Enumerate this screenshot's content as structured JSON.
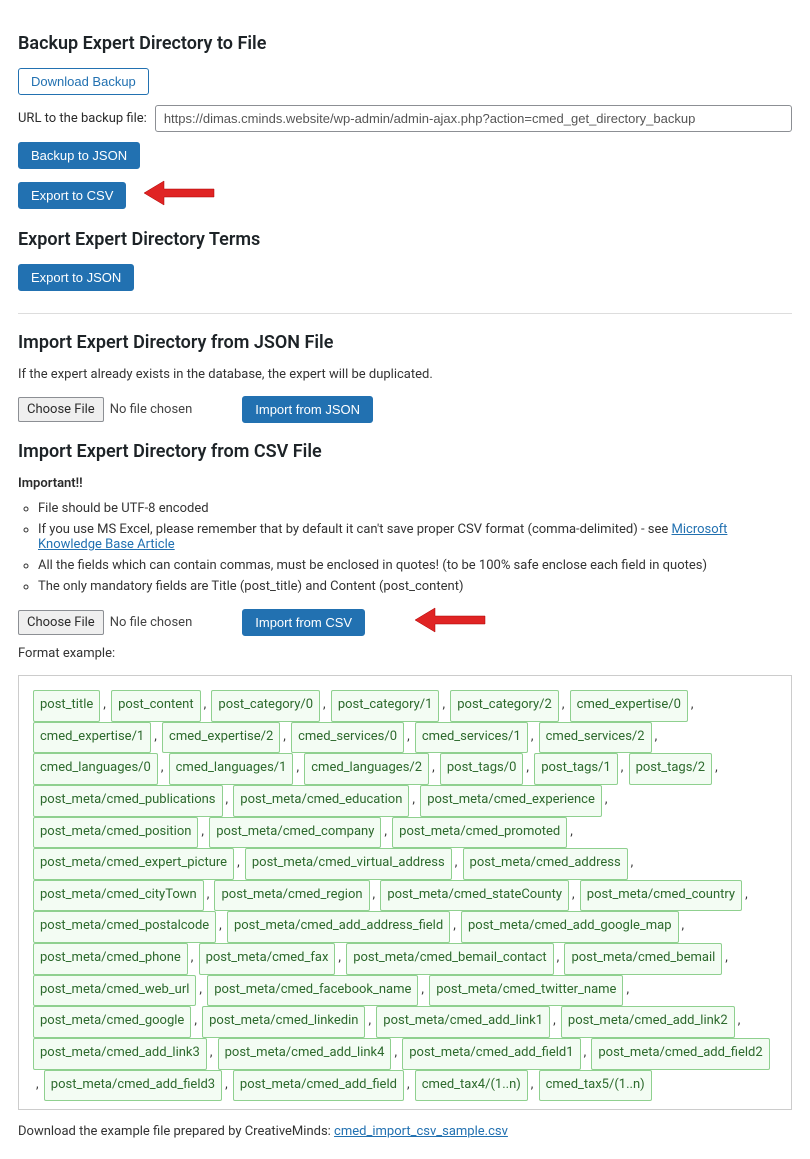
{
  "backup": {
    "heading": "Backup Expert Directory to File",
    "download_label": "Download Backup",
    "url_label": "URL to the backup file:",
    "url_value": "https://dimas.cminds.website/wp-admin/admin-ajax.php?action=cmed_get_directory_backup",
    "backup_json_label": "Backup to JSON",
    "export_csv_label": "Export to CSV"
  },
  "export_terms": {
    "heading": "Export Expert Directory Terms",
    "export_json_label": "Export to JSON"
  },
  "import_json": {
    "heading": "Import Expert Directory from JSON File",
    "note": "If the expert already exists in the database, the expert will be duplicated.",
    "choose_file_label": "Choose File",
    "no_file_label": "No file chosen",
    "import_label": "Import from JSON"
  },
  "import_csv": {
    "heading": "Import Expert Directory from CSV File",
    "important_label": "Important!!",
    "bullets": {
      "b0": "File should be UTF-8 encoded",
      "b1_prefix": "If you use MS Excel, please remember that by default it can't save proper CSV format (comma-delimited) - see ",
      "b1_link": "Microsoft Knowledge Base Article",
      "b2": "All the fields which can contain commas, must be enclosed in quotes! (to be 100% safe enclose each field in quotes)",
      "b3": "The only mandatory fields are Title (post_title) and Content (post_content)"
    },
    "choose_file_label": "Choose File",
    "no_file_label": "No file chosen",
    "import_label": "Import from CSV",
    "format_label": "Format example:",
    "download_text": "Download the example file prepared by CreativeMinds: ",
    "download_link": "cmed_import_csv_sample.csv"
  },
  "fields": [
    "post_title",
    "post_content",
    "post_category/0",
    "post_category/1",
    "post_category/2",
    "cmed_expertise/0",
    "cmed_expertise/1",
    "cmed_expertise/2",
    "cmed_services/0",
    "cmed_services/1",
    "cmed_services/2",
    "cmed_languages/0",
    "cmed_languages/1",
    "cmed_languages/2",
    "post_tags/0",
    "post_tags/1",
    "post_tags/2",
    "post_meta/cmed_publications",
    "post_meta/cmed_education",
    "post_meta/cmed_experience",
    "post_meta/cmed_position",
    "post_meta/cmed_company",
    "post_meta/cmed_promoted",
    "post_meta/cmed_expert_picture",
    "post_meta/cmed_virtual_address",
    "post_meta/cmed_address",
    "post_meta/cmed_cityTown",
    "post_meta/cmed_region",
    "post_meta/cmed_stateCounty",
    "post_meta/cmed_country",
    "post_meta/cmed_postalcode",
    "post_meta/cmed_add_address_field",
    "post_meta/cmed_add_google_map",
    "post_meta/cmed_phone",
    "post_meta/cmed_fax",
    "post_meta/cmed_bemail_contact",
    "post_meta/cmed_bemail",
    "post_meta/cmed_web_url",
    "post_meta/cmed_facebook_name",
    "post_meta/cmed_twitter_name",
    "post_meta/cmed_google",
    "post_meta/cmed_linkedin",
    "post_meta/cmed_add_link1",
    "post_meta/cmed_add_link2",
    "post_meta/cmed_add_link3",
    "post_meta/cmed_add_link4",
    "post_meta/cmed_add_field1",
    "post_meta/cmed_add_field2",
    "post_meta/cmed_add_field3",
    "post_meta/cmed_add_field",
    "cmed_tax4/(1..n)",
    "cmed_tax5/(1..n)"
  ]
}
